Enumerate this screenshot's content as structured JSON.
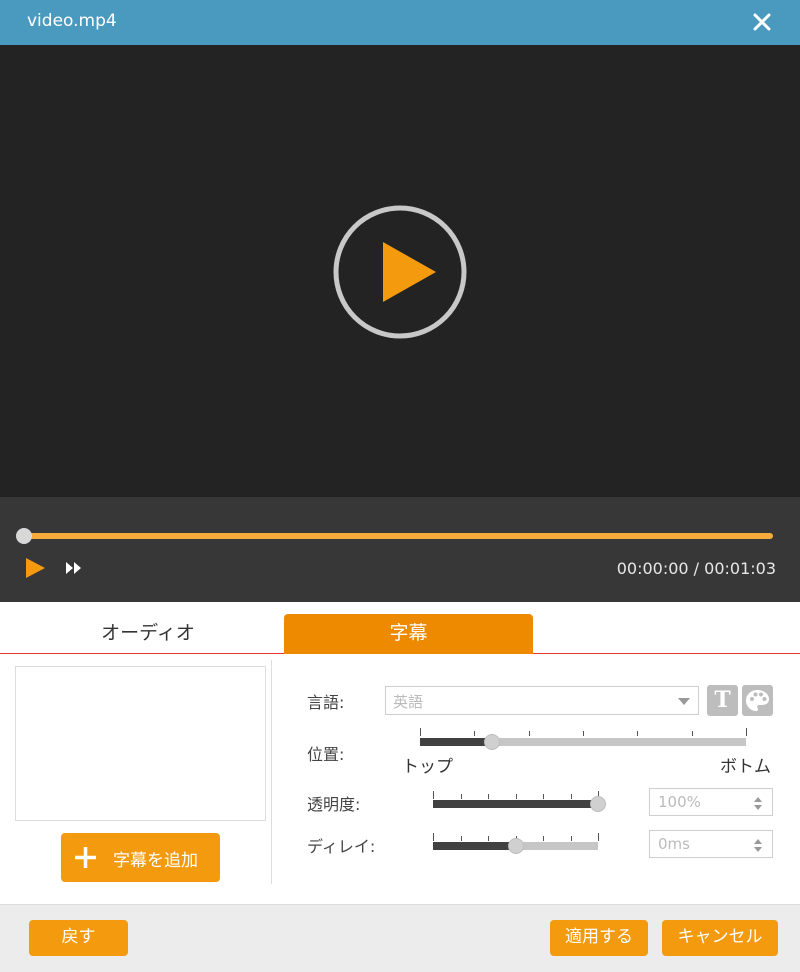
{
  "window": {
    "title": "video.mp4",
    "close_icon": "close-icon"
  },
  "player": {
    "big_play_icon": "play-circle-icon",
    "progress": 0,
    "current_time": "00:00:00",
    "separator": "/",
    "total_time": "00:01:03",
    "play_icon": "play-icon",
    "fast_forward_icon": "fast-forward-icon"
  },
  "tabs": [
    {
      "label": "オーディオ",
      "active": false
    },
    {
      "label": "字幕",
      "active": true
    }
  ],
  "subtitle_panel": {
    "add_button": {
      "label": "字幕を追加",
      "icon": "plus-icon"
    }
  },
  "settings": {
    "language": {
      "label": "言語:",
      "value": "英語",
      "font_icon_label": "T",
      "font_icon": "font-icon",
      "color_icon": "palette-icon"
    },
    "position": {
      "label": "位置:",
      "left_label": "トップ",
      "right_label": "ボトム",
      "value": 0.22,
      "ticks": 6
    },
    "transparency": {
      "label": "透明度:",
      "value": 1.0,
      "display": "100%",
      "ticks": 6
    },
    "delay": {
      "label": "ディレイ:",
      "value": 0.5,
      "display": "0ms",
      "ticks": 6
    }
  },
  "footer": {
    "back_label": "戻す",
    "apply_label": "適用する",
    "cancel_label": "キャンセル"
  },
  "colors": {
    "accent": "#f39a0f",
    "titlebar": "#4a9ac0",
    "video_bg": "#232323",
    "progress": "#f4ad3d"
  }
}
